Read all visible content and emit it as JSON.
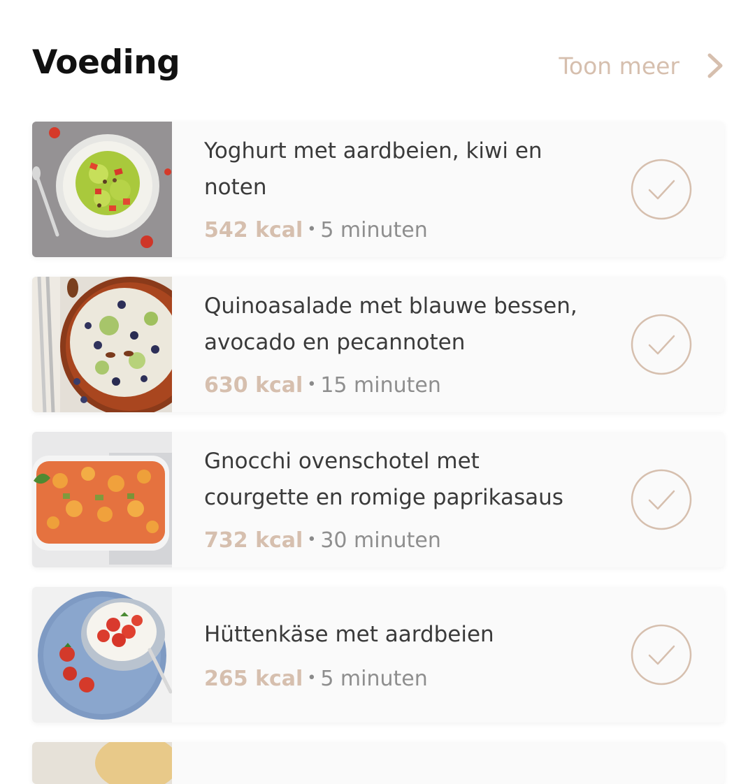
{
  "section": {
    "title": "Voeding",
    "more_label": "Toon meer"
  },
  "colors": {
    "accent": "#d6bfae",
    "title": "#111111",
    "text": "#3a3a3a",
    "muted": "#8e8e8e",
    "card": "#fafafa"
  },
  "recipes": [
    {
      "title_lines": [
        "Yoghurt met aardbeien, kiwi en",
        "noten"
      ],
      "kcal": "542 kcal",
      "separator": "•",
      "duration": "5 minuten",
      "image": "yoghurt-bowl-photo",
      "completed_icon": "check-circle-icon"
    },
    {
      "title_lines": [
        "Quinoasalade met blauwe bessen,",
        "avocado en pecannoten"
      ],
      "kcal": "630 kcal",
      "separator": "•",
      "duration": "15 minuten",
      "image": "quinoa-salad-photo",
      "completed_icon": "check-circle-icon"
    },
    {
      "title_lines": [
        "Gnocchi ovenschotel met",
        "courgette en romige paprikasaus"
      ],
      "kcal": "732 kcal",
      "separator": "•",
      "duration": "30 minuten",
      "image": "gnocchi-bake-photo",
      "completed_icon": "check-circle-icon"
    },
    {
      "title_lines": [
        "Hüttenkäse met aardbeien"
      ],
      "kcal": "265 kcal",
      "separator": "•",
      "duration": "5 minuten",
      "image": "cottage-cheese-photo",
      "completed_icon": "check-circle-icon"
    }
  ]
}
